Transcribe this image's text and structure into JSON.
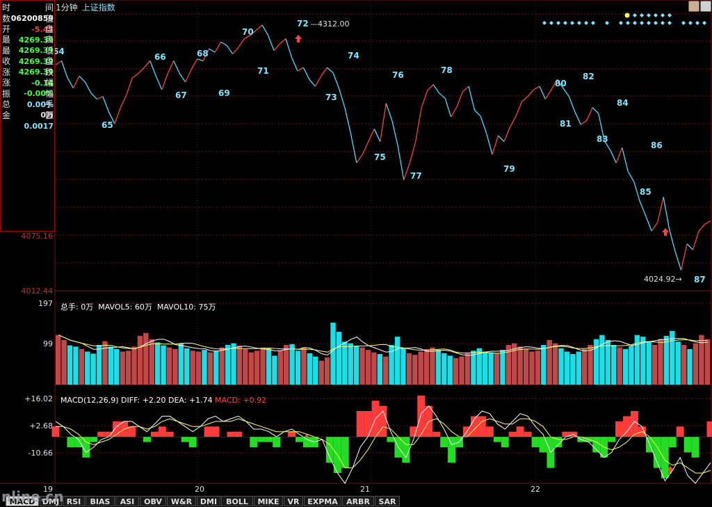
{
  "title": {
    "period": "1分钟",
    "index": "上证指数"
  },
  "info_panel": [
    {
      "label": "时",
      "label2": "间",
      "value": "06200859",
      "color": "#ffffff"
    },
    {
      "label": "数",
      "label2": "值",
      "value": "-5.45",
      "color": "#ff4040"
    },
    {
      "label": "开",
      "label2": "盘",
      "value": "4269.39",
      "color": "#40ff40"
    },
    {
      "label": "最",
      "label2": "高",
      "value": "4269.39",
      "color": "#40ff40"
    },
    {
      "label": "最",
      "label2": "低",
      "value": "4269.39",
      "color": "#40ff40"
    },
    {
      "label": "收",
      "label2": "盘",
      "value": "4269.39",
      "color": "#40ff40"
    },
    {
      "label": "涨",
      "label2": "跌",
      "value": "-0.14",
      "color": "#40ff40"
    },
    {
      "label": "涨",
      "label2": "幅",
      "value": "-0.00%",
      "color": "#40ff40"
    },
    {
      "label": "振",
      "label2": "幅",
      "value": "0.00%",
      "color": "#7fe6ff"
    },
    {
      "label": "总",
      "label2": "手",
      "value": "0万",
      "color": "#e0e0e0"
    },
    {
      "label": "金",
      "label2": "额",
      "value": "0.0017",
      "color": "#7fe6ff"
    }
  ],
  "price_panel": {
    "y_ticks": [
      "4075.16",
      "4012.44"
    ],
    "high_label": "4312.00",
    "low_label": "4024.92",
    "wave_labels": [
      "64",
      "65",
      "66",
      "67",
      "68",
      "69",
      "70",
      "71",
      "72",
      "73",
      "74",
      "75",
      "76",
      "77",
      "78",
      "79",
      "80",
      "81",
      "82",
      "83",
      "84",
      "85",
      "86",
      "87"
    ]
  },
  "volume_panel": {
    "header": {
      "total": "总手: 0万",
      "ma5": "MAVOL5: 60万",
      "ma10": "MAVOL10: 75万"
    },
    "y_ticks": [
      "197",
      "99"
    ]
  },
  "macd_panel": {
    "header": {
      "name": "MACD(12,26,9)",
      "diff": "DIFF: +2.20",
      "dea": "DEA: +1.74",
      "macd": "MACD: +0.92"
    },
    "y_ticks": [
      "+16.02",
      "+2.68",
      "-10.66"
    ]
  },
  "x_axis": [
    "19",
    "20",
    "21",
    "22"
  ],
  "tabs": [
    "MACD",
    "DMJ",
    "RSI",
    "BIAS",
    "ASI",
    "OBV",
    "W&R",
    "DMI",
    "BOLL",
    "MIKE",
    "VR",
    "EXPMA",
    "ARBR",
    "SAR"
  ],
  "watermark": "nline.cn",
  "colors": {
    "up": "#ff4040",
    "down": "#40e0ff",
    "grid": "#7a1010",
    "label": "#7fe6ff",
    "macd_pos": "#ff3b3b",
    "macd_neg": "#22dd22"
  },
  "chart_data": [
    {
      "type": "line",
      "title": "上证指数 1分钟",
      "series": [
        {
          "name": "price",
          "values": [
            4265,
            4270,
            4250,
            4238,
            4252,
            4245,
            4232,
            4225,
            4228,
            4210,
            4196,
            4215,
            4230,
            4250,
            4255,
            4262,
            4270,
            4252,
            4236,
            4255,
            4270,
            4255,
            4245,
            4260,
            4272,
            4270,
            4284,
            4280,
            4292,
            4288,
            4278,
            4286,
            4296,
            4300,
            4306,
            4312,
            4300,
            4282,
            4290,
            4296,
            4274,
            4258,
            4262,
            4248,
            4240,
            4252,
            4262,
            4256,
            4238,
            4215,
            4185,
            4150,
            4160,
            4175,
            4190,
            4175,
            4220,
            4200,
            4170,
            4130,
            4150,
            4175,
            4215,
            4235,
            4242,
            4232,
            4226,
            4204,
            4216,
            4234,
            4240,
            4212,
            4205,
            4185,
            4160,
            4182,
            4175,
            4192,
            4205,
            4222,
            4228,
            4236,
            4240,
            4225,
            4236,
            4248,
            4238,
            4228,
            4210,
            4195,
            4200,
            4215,
            4208,
            4176,
            4165,
            4150,
            4168,
            4140,
            4128,
            4105,
            4088,
            4070,
            4080,
            4110,
            4072,
            4046,
            4024,
            4055,
            4048,
            4070,
            4078,
            4082
          ]
        }
      ],
      "xlabel": "",
      "ylabel": "",
      "ylim": [
        4000,
        4325
      ],
      "grid": true
    },
    {
      "type": "bar",
      "title": "",
      "series": [
        {
          "name": "总手",
          "values": [
            120,
            108,
            95,
            92,
            86,
            80,
            75,
            96,
            105,
            92,
            86,
            80,
            82,
            92,
            118,
            125,
            110,
            102,
            95,
            90,
            86,
            100,
            88,
            82,
            80,
            84,
            78,
            82,
            90,
            96,
            100,
            94,
            86,
            78,
            82,
            90,
            88,
            70,
            82,
            96,
            98,
            82,
            90,
            76,
            68,
            58,
            66,
            150,
            128,
            104,
            100,
            94,
            90,
            84,
            78,
            74,
            68,
            96,
            116,
            88,
            76,
            72,
            80,
            86,
            90,
            84,
            76,
            70,
            64,
            68,
            76,
            82,
            88,
            80,
            78,
            76,
            84,
            96,
            100,
            92,
            86,
            80,
            82,
            96,
            108,
            100,
            88,
            80,
            74,
            80,
            86,
            96,
            110,
            120,
            108,
            96,
            90,
            86,
            94,
            120,
            116,
            104,
            96,
            110,
            118,
            130,
            104,
            96,
            86,
            100,
            120,
            110
          ]
        }
      ],
      "ylim": [
        0,
        197
      ]
    },
    {
      "type": "line",
      "title": "",
      "series": [
        {
          "name": "DIFF",
          "values": [
            6,
            4,
            1,
            -1,
            -6,
            -4,
            -1,
            0,
            4,
            6,
            6,
            4,
            2,
            5,
            8,
            8,
            6,
            4,
            2,
            4,
            7,
            8,
            6,
            7,
            8,
            6,
            3,
            3,
            2,
            0,
            2,
            3,
            1,
            -1,
            -2,
            -1,
            -8,
            -14,
            -18,
            -12,
            -4,
            0,
            7,
            10,
            2,
            -4,
            -8,
            -1,
            9,
            12,
            8,
            3,
            -3,
            -2,
            2,
            7,
            10,
            9,
            5,
            3,
            6,
            9,
            8,
            4,
            1,
            -6,
            -3,
            0,
            1,
            -1,
            -2,
            -5,
            -8,
            -6,
            -1,
            2,
            6,
            4,
            -3,
            -10,
            -17,
            -13,
            -8,
            -15,
            -18,
            -14,
            -10
          ]
        },
        {
          "name": "DEA",
          "values": [
            4,
            4,
            3,
            1,
            -2,
            -3,
            -2,
            -1,
            1,
            3,
            4,
            4,
            3,
            4,
            6,
            7,
            6,
            5,
            4,
            4,
            5,
            6,
            6,
            6,
            7,
            6,
            5,
            4,
            3,
            2,
            2,
            2,
            2,
            1,
            0,
            -1,
            -3,
            -7,
            -12,
            -12,
            -9,
            -5,
            0,
            4,
            3,
            0,
            -3,
            -3,
            1,
            6,
            7,
            5,
            2,
            0,
            0,
            3,
            6,
            7,
            6,
            5,
            5,
            7,
            7,
            6,
            4,
            0,
            -1,
            -1,
            0,
            0,
            -1,
            -2,
            -4,
            -5,
            -4,
            -2,
            1,
            2,
            0,
            -4,
            -9,
            -11,
            -10,
            -12,
            -14,
            -14,
            -13
          ]
        }
      ],
      "ylim": [
        -18,
        17
      ]
    }
  ]
}
